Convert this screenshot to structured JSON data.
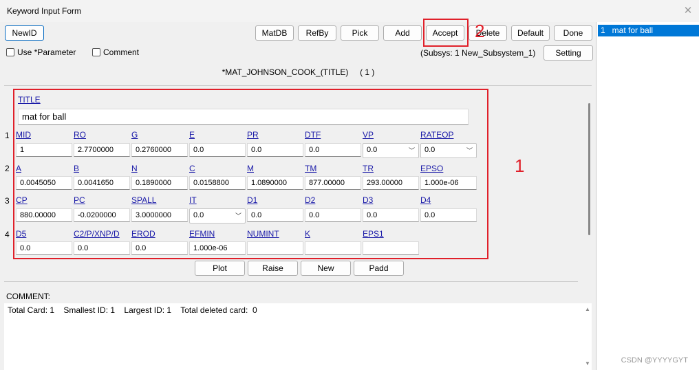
{
  "window": {
    "title": "Keyword Input Form"
  },
  "toolbar": {
    "newid": "NewID",
    "matdb": "MatDB",
    "refby": "RefBy",
    "pick": "Pick",
    "add": "Add",
    "accept": "Accept",
    "delete": "Delete",
    "default": "Default",
    "done": "Done"
  },
  "options": {
    "use_parameter": "Use *Parameter",
    "comment": "Comment"
  },
  "subsys": {
    "text": "(Subsys: 1 New_Subsystem_1)",
    "setting": "Setting"
  },
  "keyword": {
    "name": "*MAT_JOHNSON_COOK_(TITLE)",
    "count": "( 1 )"
  },
  "title_field": {
    "label": "TITLE",
    "value": "mat for ball"
  },
  "rows": [
    {
      "num": "1",
      "cells": [
        {
          "label": "MID",
          "value": "1"
        },
        {
          "label": "RO",
          "value": "2.7700000"
        },
        {
          "label": "G",
          "value": "0.2760000"
        },
        {
          "label": "E",
          "value": "0.0"
        },
        {
          "label": "PR",
          "value": "0.0"
        },
        {
          "label": "DTF",
          "value": "0.0"
        },
        {
          "label": "VP",
          "value": "0.0"
        },
        {
          "label": "RATEOP",
          "value": "0.0"
        }
      ]
    },
    {
      "num": "2",
      "cells": [
        {
          "label": "A",
          "value": "0.0045050"
        },
        {
          "label": "B",
          "value": "0.0041650"
        },
        {
          "label": "N",
          "value": "0.1890000"
        },
        {
          "label": "C",
          "value": "0.0158800"
        },
        {
          "label": "M",
          "value": "1.0890000"
        },
        {
          "label": "TM",
          "value": "877.00000"
        },
        {
          "label": "TR",
          "value": "293.00000"
        },
        {
          "label": "EPSO",
          "value": "1.000e-06"
        }
      ]
    },
    {
      "num": "3",
      "cells": [
        {
          "label": "CP",
          "value": "880.00000"
        },
        {
          "label": "PC",
          "value": "-0.0200000"
        },
        {
          "label": "SPALL",
          "value": "3.0000000"
        },
        {
          "label": "IT",
          "value": "0.0"
        },
        {
          "label": "D1",
          "value": "0.0"
        },
        {
          "label": "D2",
          "value": "0.0"
        },
        {
          "label": "D3",
          "value": "0.0"
        },
        {
          "label": "D4",
          "value": "0.0"
        }
      ]
    },
    {
      "num": "4",
      "cells": [
        {
          "label": "D5",
          "value": "0.0"
        },
        {
          "label": "C2/P/XNP/D",
          "value": "0.0"
        },
        {
          "label": "EROD",
          "value": "0.0"
        },
        {
          "label": "EFMIN",
          "value": "1.000e-06"
        },
        {
          "label": "NUMINT",
          "value": ""
        },
        {
          "label": "K",
          "value": ""
        },
        {
          "label": "EPS1",
          "value": ""
        }
      ]
    }
  ],
  "bottom_buttons": {
    "plot": "Plot",
    "raise": "Raise",
    "new": "New",
    "padd": "Padd"
  },
  "comment": {
    "label": "COMMENT:",
    "summary": "Total Card: 1    Smallest ID: 1    Largest ID: 1    Total deleted card:  0"
  },
  "annotations": {
    "box1": "1",
    "box2": "2",
    "color": "#e0202a"
  },
  "list": {
    "items": [
      "1   mat for ball"
    ]
  },
  "watermark": "CSDN @YYYYGYT",
  "colors": {
    "selection": "#0078d7",
    "link": "#1a1aa8"
  }
}
